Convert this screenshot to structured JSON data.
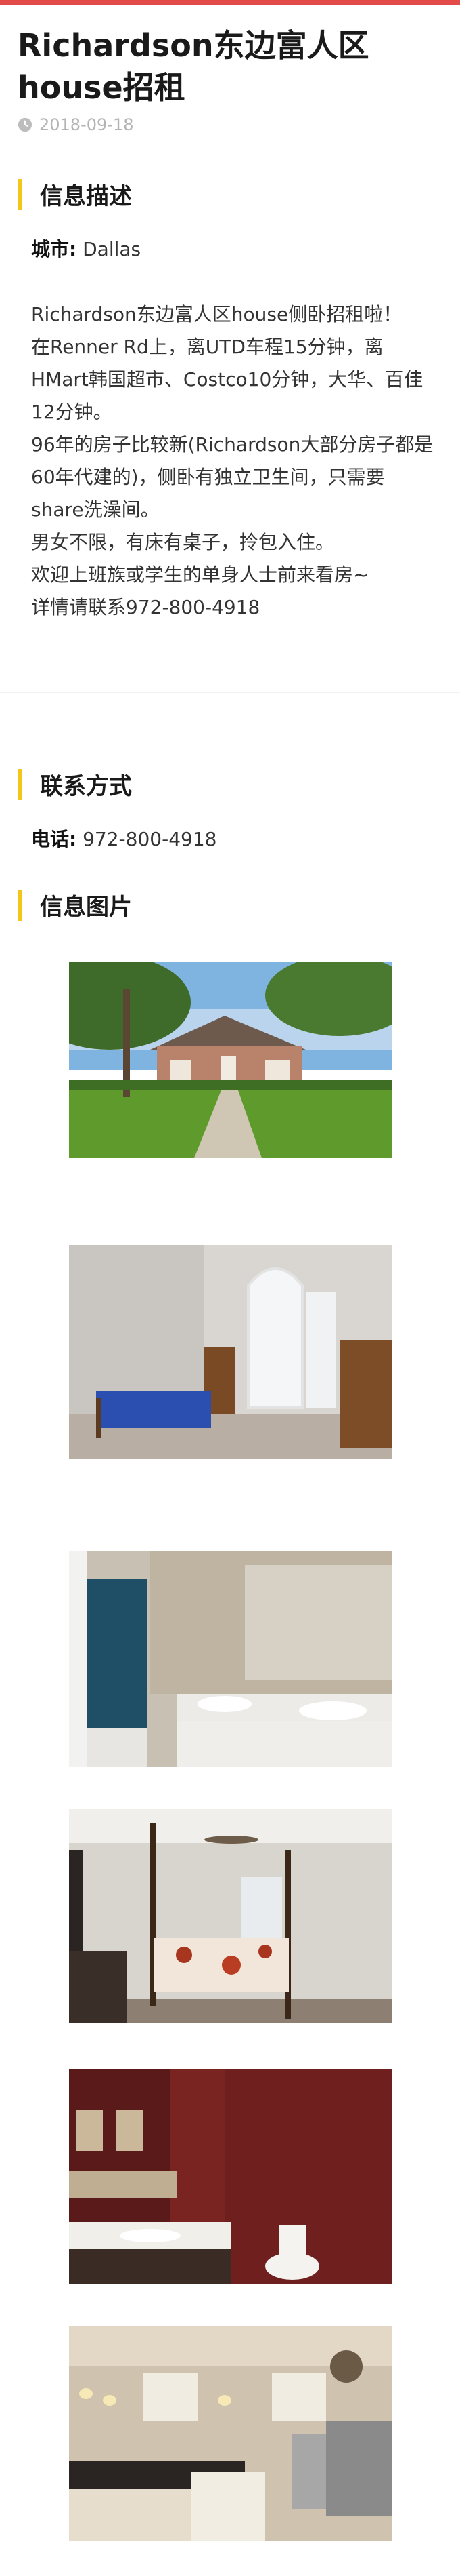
{
  "post": {
    "title": "Richardson东边富人区house招租",
    "date": "2018-09-18"
  },
  "info": {
    "heading": "信息描述",
    "city_label": "城市:",
    "city_value": "Dallas",
    "description": [
      "Richardson东边富人区house侧卧招租啦！",
      "在Renner Rd上，离UTD车程15分钟，离HMart韩国超市、Costco10分钟，大华、百佳12分钟。",
      "96年的房子比较新(Richardson大部分房子都是60年代建的)，侧卧有独立卫生间，只需要share洗澡间。",
      "男女不限，有床有桌子，拎包入住。",
      "欢迎上班族或学生的单身人士前来看房~",
      "详情请联系972-800-4918"
    ]
  },
  "contact": {
    "heading": "联系方式",
    "phone_label": "电话:",
    "phone_value": "972-800-4918"
  },
  "gallery": {
    "heading": "信息图片",
    "photos": [
      {
        "name": "house-exterior"
      },
      {
        "name": "bedroom-blue-bed"
      },
      {
        "name": "bathroom-double-sink"
      },
      {
        "name": "master-bedroom-canopy"
      },
      {
        "name": "powder-room-red"
      },
      {
        "name": "kitchen"
      }
    ]
  },
  "colors": {
    "accent_bar": "#f5c518",
    "top_stripe": "#e34b4b",
    "date_gray": "#b3b3b3"
  }
}
